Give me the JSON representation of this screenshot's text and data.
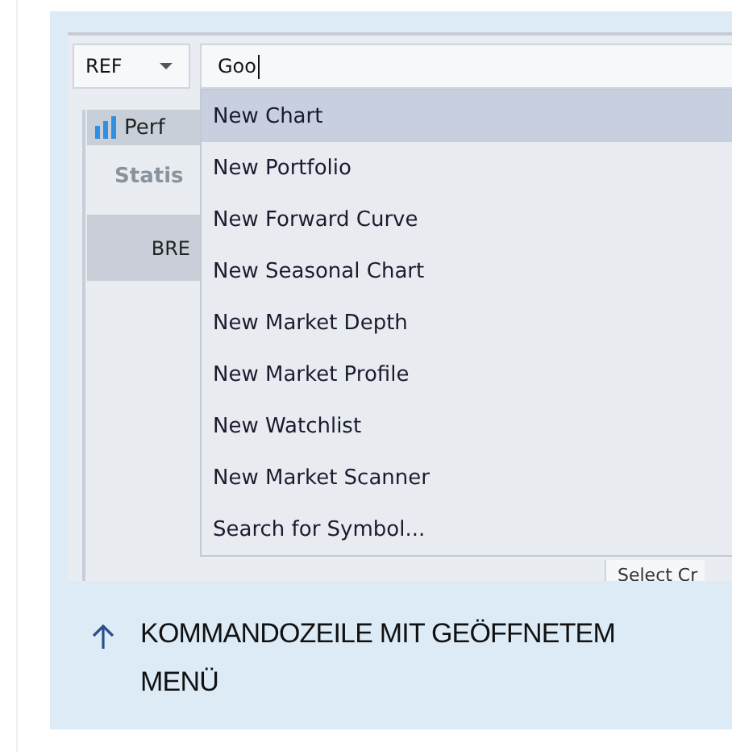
{
  "toolbar": {
    "symbol_type": "REF",
    "command": {
      "value": "Goo"
    }
  },
  "background_panel": {
    "tab": {
      "label": "Perf"
    },
    "header": "Statis",
    "row": "BRE",
    "bottom_label": "Select Cr"
  },
  "menu": {
    "items": [
      {
        "label": "New Chart",
        "selected": true
      },
      {
        "label": "New Portfolio",
        "selected": false
      },
      {
        "label": "New Forward Curve",
        "selected": false
      },
      {
        "label": "New Seasonal Chart",
        "selected": false
      },
      {
        "label": "New Market Depth",
        "selected": false
      },
      {
        "label": "New Market Profile",
        "selected": false
      },
      {
        "label": "New Watchlist",
        "selected": false
      },
      {
        "label": "New Market Scanner",
        "selected": false
      },
      {
        "label": "Search for Symbol...",
        "selected": false
      }
    ]
  },
  "caption": {
    "text": "KOMMANDOZEILE MIT GEÖFFNETEM MENÜ"
  }
}
